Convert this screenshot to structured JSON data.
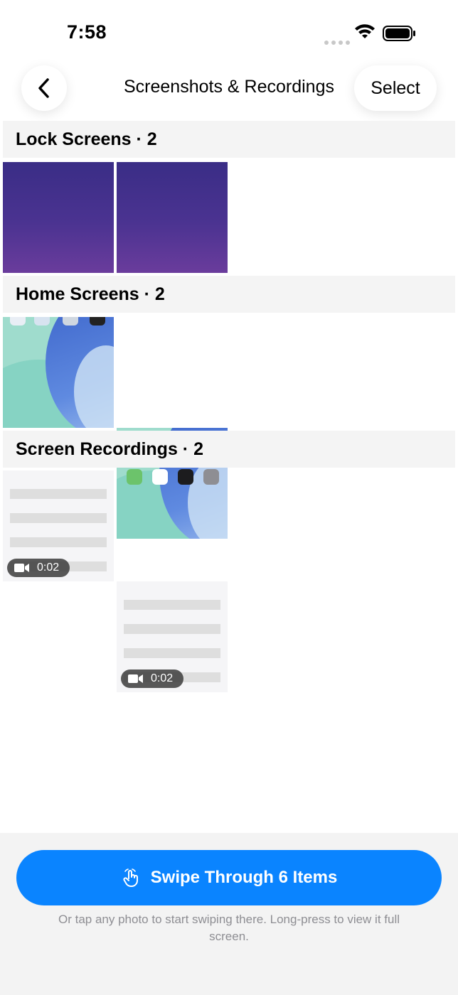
{
  "status_bar": {
    "time": "7:58"
  },
  "nav": {
    "title": "Screenshots & Recordings",
    "select_label": "Select"
  },
  "sections": [
    {
      "title": "Lock Screens · 2",
      "kind": "lock"
    },
    {
      "title": "Home Screens · 2",
      "kind": "home"
    },
    {
      "title": "Screen Recordings · 2",
      "kind": "recording",
      "durations": [
        "0:02",
        "0:02"
      ]
    }
  ],
  "bottom": {
    "swipe_label": "Swipe Through 6 Items",
    "hint": "Or tap any photo to start swiping there. Long-press to view it full screen."
  },
  "colors": {
    "accent": "#0a84ff",
    "section_bg": "#f4f4f4",
    "bottom_bg": "#f3f3f3"
  },
  "icons": [
    "back-chevron-icon",
    "wifi-icon",
    "battery-icon",
    "video-camera-icon",
    "hand-tap-icon"
  ]
}
